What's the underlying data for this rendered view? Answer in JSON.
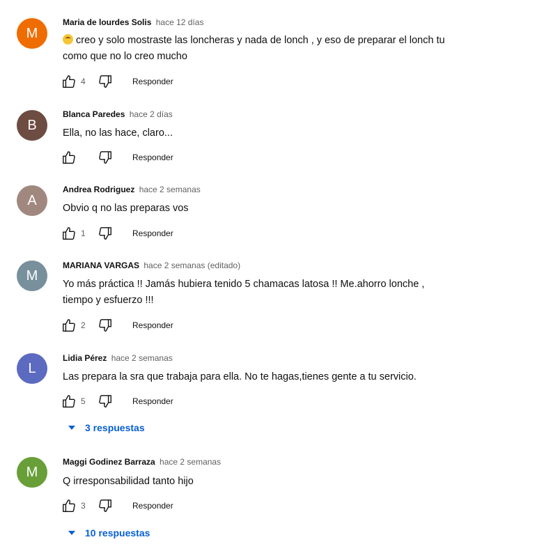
{
  "colors": {
    "avatar_orange": "#ef6c00",
    "avatar_brown": "#6d4c41",
    "avatar_rose": "#a1887f",
    "avatar_slate": "#78909c",
    "avatar_indigo": "#5c6bc0",
    "avatar_green": "#689f38",
    "link_blue": "#065fd4"
  },
  "reply_label": "Responder",
  "comments": [
    {
      "initial": "M",
      "author": "Maria de lourdes Solis",
      "time": "hace 12 días",
      "emoji": "thinking-face-emoji",
      "line1": "creo y solo mostraste las loncheras y nada de lonch , y eso de preparar el lonch tu",
      "line2": "como que no lo creo mucho",
      "likes": "4"
    },
    {
      "initial": "B",
      "author": "Blanca Paredes",
      "time": "hace 2 días",
      "line1": "Ella, no las hace, claro...",
      "likes": ""
    },
    {
      "initial": "A",
      "author": "Andrea Rodriguez",
      "time": "hace 2 semanas",
      "line1": "Obvio q no las preparas vos",
      "likes": "1"
    },
    {
      "initial": "M",
      "author": "MARIANA VARGAS",
      "time": "hace 2 semanas (editado)",
      "line1": "Yo más práctica !! Jamás hubiera tenido 5 chamacas latosa !! Me.ahorro lonche ,",
      "line2": "tiempo y esfuerzo !!!",
      "likes": "2"
    },
    {
      "initial": "L",
      "author": "Lidia Pérez",
      "time": "hace 2 semanas",
      "line1": "Las prepara la sra que trabaja para ella. No te hagas,tienes gente a tu servicio.",
      "likes": "5",
      "replies": "3 respuestas"
    },
    {
      "initial": "M",
      "author": "Maggi Godinez Barraza",
      "time": "hace 2 semanas",
      "line1": "Q irresponsabilidad tanto hijo",
      "likes": "3",
      "replies": "10 respuestas"
    }
  ]
}
